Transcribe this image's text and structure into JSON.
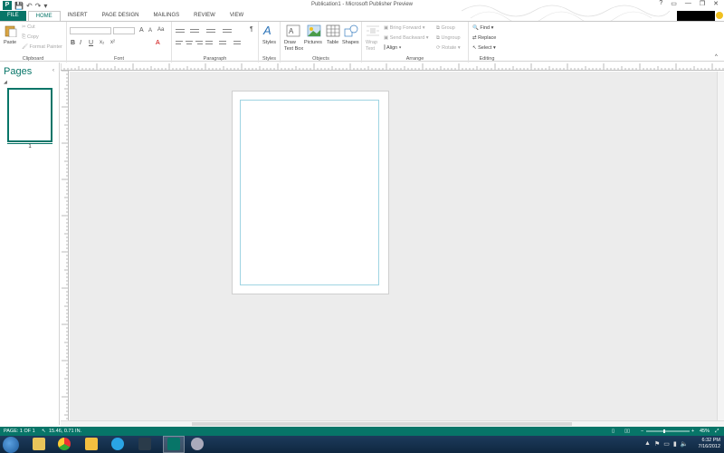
{
  "app": {
    "title": "Publication1 - Microsoft Publisher Preview",
    "window_controls": [
      "?",
      "▭",
      "—",
      "❐",
      "✕"
    ]
  },
  "tabs": [
    "FILE",
    "HOME",
    "INSERT",
    "PAGE DESIGN",
    "MAILINGS",
    "REVIEW",
    "VIEW"
  ],
  "ribbon": {
    "clipboard": {
      "label": "Clipboard",
      "paste": "Paste",
      "cut": "Cut",
      "copy": "Copy",
      "format_painter": "Format Painter"
    },
    "font": {
      "label": "Font",
      "bold": "B",
      "italic": "I",
      "underline": "U",
      "subscript": "x₂",
      "superscript": "x²",
      "clear": "Aa",
      "grow": "A",
      "shrink": "A",
      "color": "A"
    },
    "paragraph": {
      "label": "Paragraph",
      "pilcrow": "¶"
    },
    "styles": {
      "label": "Styles",
      "btn": "Styles"
    },
    "objects": {
      "label": "Objects",
      "draw_text_box": "Draw Text Box",
      "pictures": "Pictures",
      "table": "Table",
      "shapes": "Shapes"
    },
    "arrange": {
      "label": "Arrange",
      "wrap_text": "Wrap Text",
      "bring_forward": "Bring Forward",
      "send_backward": "Send Backward",
      "align": "Align",
      "group": "Group",
      "ungroup": "Ungroup",
      "rotate": "Rotate"
    },
    "editing": {
      "label": "Editing",
      "find": "Find",
      "replace": "Replace",
      "select": "Select"
    }
  },
  "pages_pane": {
    "title": "Pages",
    "page_number": "1"
  },
  "status": {
    "page": "PAGE: 1 OF 1",
    "position": "15.46, 0.71 IN.",
    "zoom": "45%"
  },
  "tray": {
    "time": "6:32 PM",
    "date": "7/16/2012"
  },
  "colors": {
    "accent": "#077568",
    "margin_guide": "#9fd4e2"
  }
}
